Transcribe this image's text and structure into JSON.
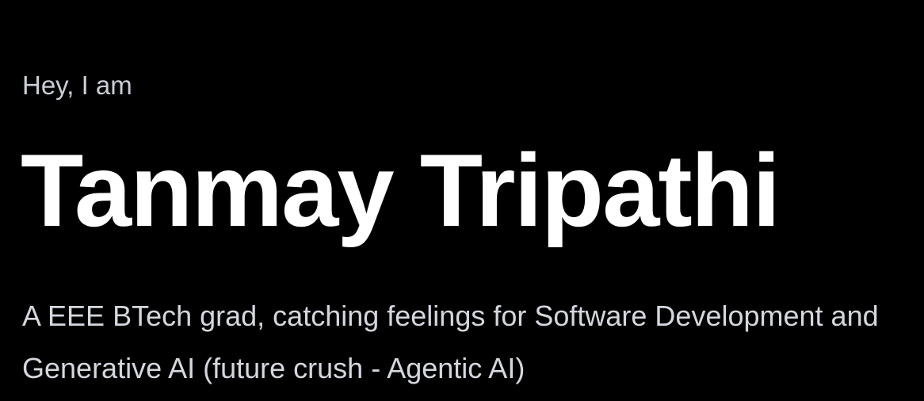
{
  "hero": {
    "greeting": "Hey, I am",
    "name": "Tanmay Tripathi",
    "tagline": "A EEE BTech grad, catching feelings for Software Development and Generative AI (future crush - Agentic AI)"
  },
  "colors": {
    "background": "#000000",
    "name": "#ffffff",
    "greeting": "#c9cdd6",
    "tagline": "#d4d7de"
  }
}
